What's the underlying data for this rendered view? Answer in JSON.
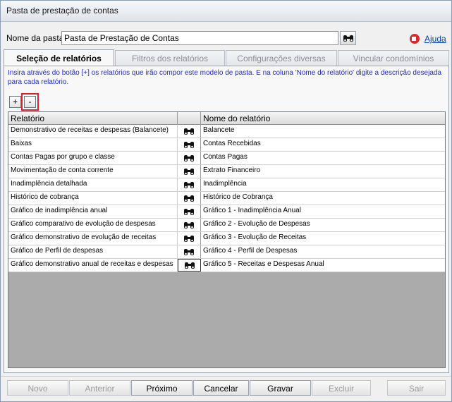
{
  "window": {
    "title": "Pasta de prestação de contas"
  },
  "header": {
    "folder_label": "Nome da pasta:",
    "folder_value": "Pasta de Prestação de Contas",
    "help_label": "Ajuda"
  },
  "tabs": [
    {
      "label": "Seleção de relatórios",
      "active": true
    },
    {
      "label": "Filtros dos relatórios",
      "active": false
    },
    {
      "label": "Configurações diversas",
      "active": false
    },
    {
      "label": "Vincular condomínios",
      "active": false
    }
  ],
  "instructions": "Insira através do botão [+] os relatórios que irão compor este modelo de pasta. E na coluna 'Nome do relatório' digite a descrição desejada para cada relatório.",
  "toolbar": {
    "add_label": "+",
    "remove_label": "-"
  },
  "grid": {
    "columns": {
      "relatorio": "Relatório",
      "button": "",
      "nome": "Nome do relatório"
    },
    "rows": [
      {
        "relatorio": "Demonstrativo de receitas e despesas (Balancete)",
        "nome": "Balancete"
      },
      {
        "relatorio": "Baixas",
        "nome": "Contas Recebidas"
      },
      {
        "relatorio": "Contas Pagas por grupo e classe",
        "nome": "Contas Pagas"
      },
      {
        "relatorio": "Movimentação de conta corrente",
        "nome": "Extrato Financeiro"
      },
      {
        "relatorio": "Inadimplência detalhada",
        "nome": "Inadimplência"
      },
      {
        "relatorio": "Histórico de cobrança",
        "nome": "Histórico de Cobrança"
      },
      {
        "relatorio": "Gráfico de inadimplência anual",
        "nome": "Gráfico 1 - Inadimplência Anual"
      },
      {
        "relatorio": "Gráfico comparativo de evolução de despesas",
        "nome": "Gráfico 2 - Evolução de Despesas"
      },
      {
        "relatorio": "Gráfico demonstrativo de evolução de receitas",
        "nome": "Gráfico 3 - Evolução de Receitas"
      },
      {
        "relatorio": "Gráfico de Perfil de despesas",
        "nome": "Gráfico 4 - Perfil de Despesas"
      },
      {
        "relatorio": "Gráfico demonstrativo anual de receitas e despesas",
        "nome": "Gráfico 5 - Receitas e Despesas Anual"
      }
    ]
  },
  "buttons": {
    "novo": "Novo",
    "anterior": "Anterior",
    "proximo": "Próximo",
    "cancelar": "Cancelar",
    "gravar": "Gravar",
    "excluir": "Excluir",
    "sair": "Sair"
  },
  "icons": {
    "search": "binoculars-icon",
    "help": "help-video-icon"
  },
  "colors": {
    "instructions": "#1f2ad0",
    "highlight": "#e02020",
    "link": "#0645ad"
  }
}
